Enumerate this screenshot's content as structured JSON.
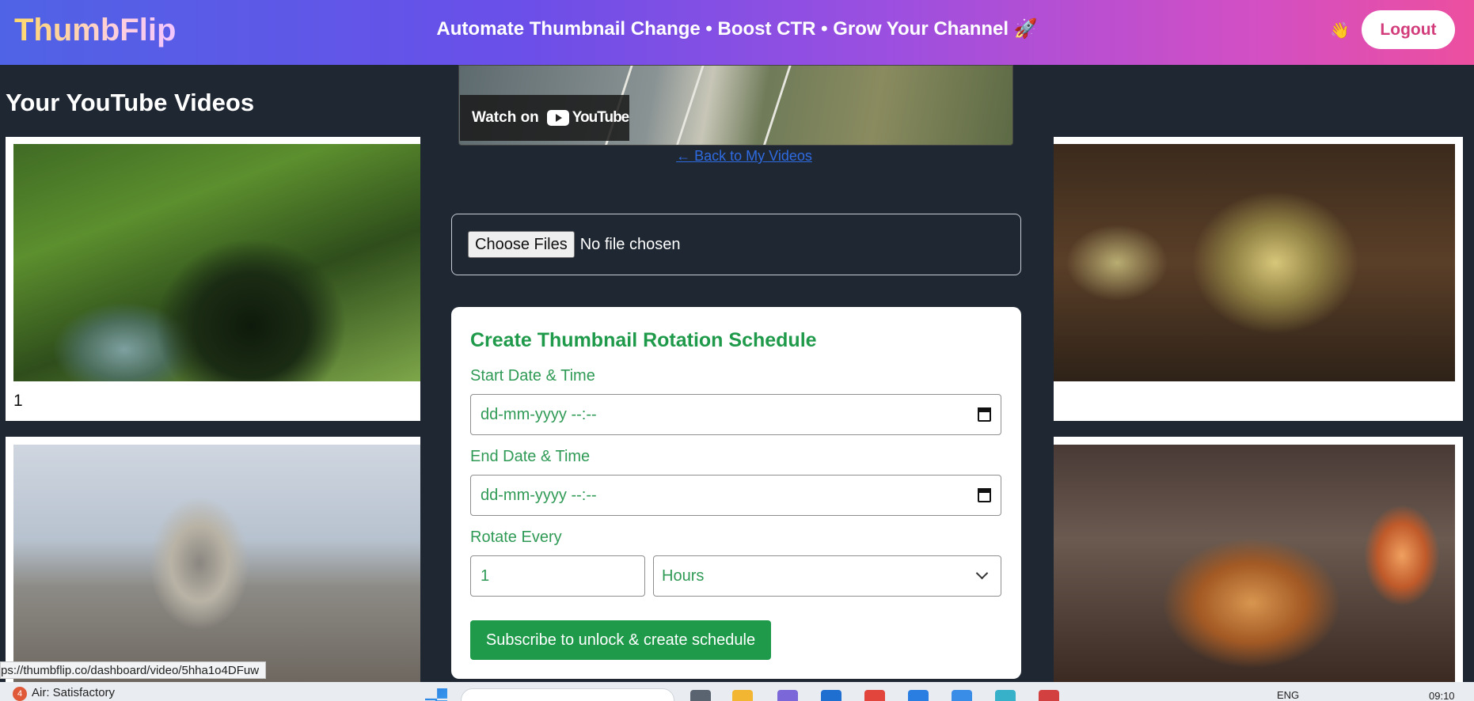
{
  "header": {
    "brand": "ThumbFlip",
    "tagline": "Automate Thumbnail Change • Boost CTR • Grow Your Channel 🚀",
    "wave_emoji": "👋",
    "logout_label": "Logout"
  },
  "dashboard": {
    "title": "Your YouTube Videos",
    "cards": [
      {
        "label": "1",
        "thumb": "forest-waterfall"
      },
      {
        "label": "",
        "thumb": "teapot"
      },
      {
        "label": "",
        "thumb": "museum-dome"
      },
      {
        "label": "",
        "thumb": "croissants"
      }
    ]
  },
  "modal": {
    "video": {
      "watch_label": "Watch on",
      "yt_label": "YouTube"
    },
    "back_link": "← Back to My Videos",
    "file_input": {
      "button_label": "Choose Files",
      "status": "No file chosen"
    },
    "schedule": {
      "title": "Create Thumbnail Rotation Schedule",
      "start_label": "Start Date & Time",
      "start_placeholder": "dd-mm-yyyy --:--",
      "end_label": "End Date & Time",
      "end_placeholder": "dd-mm-yyyy --:--",
      "rotate_label": "Rotate Every",
      "rotate_value": "1",
      "rotate_unit": "Hours",
      "submit_label": "Subscribe to unlock & create schedule"
    }
  },
  "status_bar": {
    "url": "ps://thumbflip.co/dashboard/video/5hha1o4DFuw"
  },
  "taskbar": {
    "aq_badge": "4",
    "aq_text": "Air: Satisfactory",
    "lang": "ENG",
    "time": "09:10"
  },
  "colors": {
    "accent_green": "#1e9a4a",
    "logout_text": "#d23c7a",
    "link_blue": "#2f6be0"
  }
}
